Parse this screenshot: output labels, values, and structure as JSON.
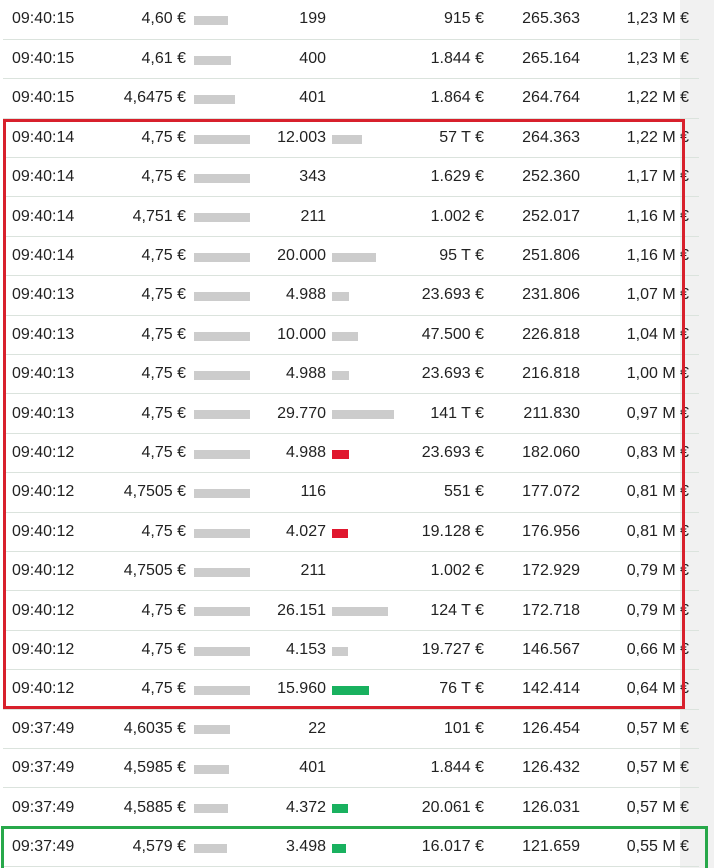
{
  "colors": {
    "bar_neutral": "#cccccc",
    "bar_sell": "#e0172e",
    "bar_buy": "#19b15f",
    "highlight_red": "#d8202c",
    "highlight_green": "#27a84a"
  },
  "trades": [
    {
      "time": "09:40:15",
      "price": "4,60 €",
      "price_level": 0.36,
      "volume": "199",
      "volume_level": 0,
      "volume_color": "neutral",
      "turnover": "915 €",
      "cum_volume": "265.363",
      "cum_turnover": "1,23 M €"
    },
    {
      "time": "09:40:15",
      "price": "4,61 €",
      "price_level": 0.43,
      "volume": "400",
      "volume_level": 0,
      "volume_color": "neutral",
      "turnover": "1.844 €",
      "cum_volume": "265.164",
      "cum_turnover": "1,23 M €"
    },
    {
      "time": "09:40:15",
      "price": "4,6475 €",
      "price_level": 0.57,
      "volume": "401",
      "volume_level": 0,
      "volume_color": "neutral",
      "turnover": "1.864 €",
      "cum_volume": "264.764",
      "cum_turnover": "1,22 M €"
    },
    {
      "time": "09:40:14",
      "price": "4,75 €",
      "price_level": 1.0,
      "volume": "12.003",
      "volume_level": 0.4,
      "volume_color": "neutral",
      "turnover": "57 T €",
      "cum_volume": "264.363",
      "cum_turnover": "1,22 M €"
    },
    {
      "time": "09:40:14",
      "price": "4,75 €",
      "price_level": 1.0,
      "volume": "343",
      "volume_level": 0,
      "volume_color": "neutral",
      "turnover": "1.629 €",
      "cum_volume": "252.360",
      "cum_turnover": "1,17 M €"
    },
    {
      "time": "09:40:14",
      "price": "4,751 €",
      "price_level": 1.0,
      "volume": "211",
      "volume_level": 0,
      "volume_color": "neutral",
      "turnover": "1.002 €",
      "cum_volume": "252.017",
      "cum_turnover": "1,16 M €"
    },
    {
      "time": "09:40:14",
      "price": "4,75 €",
      "price_level": 1.0,
      "volume": "20.000",
      "volume_level": 0.67,
      "volume_color": "neutral",
      "turnover": "95 T €",
      "cum_volume": "251.806",
      "cum_turnover": "1,16 M €"
    },
    {
      "time": "09:40:13",
      "price": "4,75 €",
      "price_level": 1.0,
      "volume": "4.988",
      "volume_level": 0.17,
      "volume_color": "neutral",
      "turnover": "23.693 €",
      "cum_volume": "231.806",
      "cum_turnover": "1,07 M €"
    },
    {
      "time": "09:40:13",
      "price": "4,75 €",
      "price_level": 1.0,
      "volume": "10.000",
      "volume_level": 0.34,
      "volume_color": "neutral",
      "turnover": "47.500 €",
      "cum_volume": "226.818",
      "cum_turnover": "1,04 M €"
    },
    {
      "time": "09:40:13",
      "price": "4,75 €",
      "price_level": 1.0,
      "volume": "4.988",
      "volume_level": 0.17,
      "volume_color": "neutral",
      "turnover": "23.693 €",
      "cum_volume": "216.818",
      "cum_turnover": "1,00 M €"
    },
    {
      "time": "09:40:13",
      "price": "4,75 €",
      "price_level": 1.0,
      "volume": "29.770",
      "volume_level": 1.0,
      "volume_color": "neutral",
      "turnover": "141 T €",
      "cum_volume": "211.830",
      "cum_turnover": "0,97 M €"
    },
    {
      "time": "09:40:12",
      "price": "4,75 €",
      "price_level": 1.0,
      "volume": "4.988",
      "volume_level": 0.17,
      "volume_color": "sell",
      "turnover": "23.693 €",
      "cum_volume": "182.060",
      "cum_turnover": "0,83 M €"
    },
    {
      "time": "09:40:12",
      "price": "4,7505 €",
      "price_level": 1.0,
      "volume": "116",
      "volume_level": 0,
      "volume_color": "neutral",
      "turnover": "551 €",
      "cum_volume": "177.072",
      "cum_turnover": "0,81 M €"
    },
    {
      "time": "09:40:12",
      "price": "4,75 €",
      "price_level": 1.0,
      "volume": "4.027",
      "volume_level": 0.14,
      "volume_color": "sell",
      "turnover": "19.128 €",
      "cum_volume": "176.956",
      "cum_turnover": "0,81 M €"
    },
    {
      "time": "09:40:12",
      "price": "4,7505 €",
      "price_level": 1.0,
      "volume": "211",
      "volume_level": 0,
      "volume_color": "neutral",
      "turnover": "1.002 €",
      "cum_volume": "172.929",
      "cum_turnover": "0,79 M €"
    },
    {
      "time": "09:40:12",
      "price": "4,75 €",
      "price_level": 1.0,
      "volume": "26.151",
      "volume_level": 0.88,
      "volume_color": "neutral",
      "turnover": "124 T €",
      "cum_volume": "172.718",
      "cum_turnover": "0,79 M €"
    },
    {
      "time": "09:40:12",
      "price": "4,75 €",
      "price_level": 1.0,
      "volume": "4.153",
      "volume_level": 0.14,
      "volume_color": "neutral",
      "turnover": "19.727 €",
      "cum_volume": "146.567",
      "cum_turnover": "0,66 M €"
    },
    {
      "time": "09:40:12",
      "price": "4,75 €",
      "price_level": 1.0,
      "volume": "15.960",
      "volume_level": 0.54,
      "volume_color": "buy",
      "turnover": "76 T €",
      "cum_volume": "142.414",
      "cum_turnover": "0,64 M €"
    },
    {
      "time": "09:37:49",
      "price": "4,6035 €",
      "price_level": 0.41,
      "volume": "22",
      "volume_level": 0,
      "volume_color": "neutral",
      "turnover": "101 €",
      "cum_volume": "126.454",
      "cum_turnover": "0,57 M €"
    },
    {
      "time": "09:37:49",
      "price": "4,5985 €",
      "price_level": 0.38,
      "volume": "401",
      "volume_level": 0,
      "volume_color": "neutral",
      "turnover": "1.844 €",
      "cum_volume": "126.432",
      "cum_turnover": "0,57 M €"
    },
    {
      "time": "09:37:49",
      "price": "4,5885 €",
      "price_level": 0.34,
      "volume": "4.372",
      "volume_level": 0.15,
      "volume_color": "buy",
      "turnover": "20.061 €",
      "cum_volume": "126.031",
      "cum_turnover": "0,57 M €"
    },
    {
      "time": "09:37:49",
      "price": "4,579 €",
      "price_level": 0.32,
      "volume": "3.498",
      "volume_level": 0.12,
      "volume_color": "buy",
      "turnover": "16.017 €",
      "cum_volume": "121.659",
      "cum_turnover": "0,55 M €"
    }
  ]
}
